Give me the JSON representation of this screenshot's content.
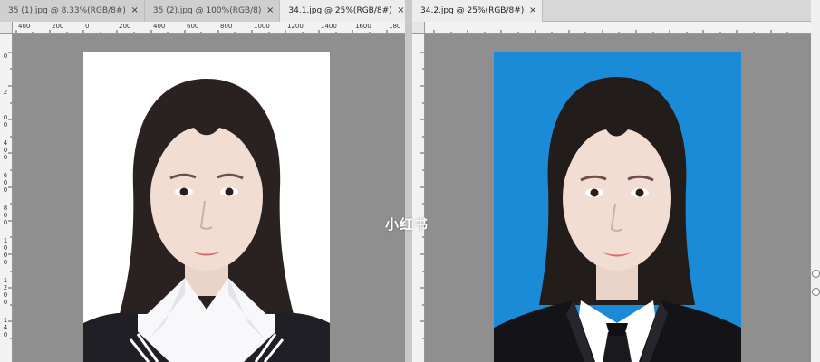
{
  "left_window": {
    "tabs": [
      {
        "label": "35 (1).jpg @ 8.33%(RGB/8#)",
        "active": false
      },
      {
        "label": "35 (2).jpg @ 100%(RGB/8)",
        "active": false
      },
      {
        "label": "34.1.jpg @ 25%(RGB/8#)",
        "active": true
      }
    ],
    "ruler_h": [
      "400",
      "200",
      "0",
      "200",
      "400",
      "600",
      "800",
      "1000",
      "1200",
      "1400",
      "1600",
      "180"
    ],
    "ruler_v": [
      "0",
      "2",
      "0 0",
      "4 0 0",
      "6 0 0",
      "8 0 0",
      "1 0 0 0",
      "1 2 0 0",
      "1 4 0"
    ],
    "background_color": "#ffffff"
  },
  "right_window": {
    "tabs": [
      {
        "label": "34.2.jpg @ 25%(RGB/8#)",
        "active": true
      }
    ],
    "background_color": "#1b8bd8"
  },
  "icons": {
    "close": "×"
  },
  "watermark": "小红书"
}
